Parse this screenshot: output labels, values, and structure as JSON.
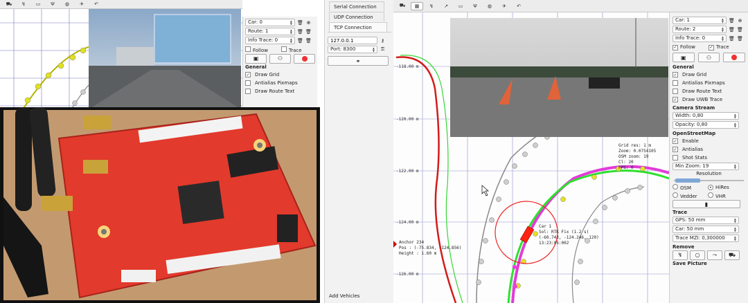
{
  "left_app": {
    "car_label": "Car: 0",
    "route_label": "Route: 1",
    "info_trace_label": "Info Trace: 0",
    "follow_label": "Follow",
    "trace_label": "Trace",
    "general_title": "General",
    "options": [
      {
        "label": "Draw Grid",
        "checked": true
      },
      {
        "label": "Antialias Pixmaps",
        "checked": false
      },
      {
        "label": "Draw Route Text",
        "checked": false
      }
    ]
  },
  "connection": {
    "tabs": [
      "Serial Connection",
      "UDP Connection",
      "TCP Connection"
    ],
    "host": "127.0.0.1",
    "port": "Port: 8300",
    "add_vehicles_label": "Add Vehicles"
  },
  "right_app": {
    "car_label": "Car: 1",
    "route_label": "Route: 2",
    "info_trace_label": "Info Trace: 0",
    "follow_label": "Follow",
    "trace_label": "Trace",
    "general_title": "General",
    "general_options": [
      {
        "label": "Draw Grid",
        "checked": true
      },
      {
        "label": "Antialias Pixmaps",
        "checked": false
      },
      {
        "label": "Draw Route Text",
        "checked": false
      },
      {
        "label": "Draw UWB Trace",
        "checked": true
      }
    ],
    "camera_stream_title": "Camera Stream",
    "width_value": "Width: 0,80",
    "opacity_value": "Opacity: 0,80",
    "osm_title": "OpenStreetMap",
    "osm_options": [
      {
        "label": "Enable",
        "checked": true
      },
      {
        "label": "Antialias",
        "checked": true
      },
      {
        "label": "Shot Stats",
        "checked": false
      }
    ],
    "min_zoom_value": "Min Zoom: 19",
    "resolution_label": "Resolution",
    "radio_osm": "OSM",
    "radio_hires": "HiRes",
    "radio_vedder": "Vedder",
    "radio_vhr": "VHR",
    "trace_title": "Trace",
    "gps_value": "GPS: 50 mm",
    "car_value": "Car: 50 mm",
    "trace_mzi_value": "Trace MZI: 0,300000",
    "remove_title": "Remove",
    "save_picture_label": "Save Picture"
  },
  "map": {
    "y_ticks": [
      "-118.00 m",
      "-120.00 m",
      "-122.00 m",
      "-124.00 m",
      "-126.00 m"
    ],
    "info_lines": [
      "Grid res: 1 m",
      "Zoom: 0.0754105",
      "OSM zoom: 19",
      "Cl: 20",
      "FPS: 0"
    ],
    "anchor_lines": [
      "Anchor 234",
      "Pos : (-75.834, -124.856)",
      "Height : 1.60 m"
    ],
    "car_lines": [
      "Car 1",
      "Sol: RTK Fix (1.2 s)",
      "(-60.743, -124.246, 120)",
      "13:23:05:002"
    ]
  },
  "icons": {
    "toolbar": [
      "car-icon",
      "map-icon",
      "route-icon",
      "screen-icon",
      "antenna-icon",
      "globe-icon",
      "plane-icon",
      "arrow-icon"
    ]
  }
}
